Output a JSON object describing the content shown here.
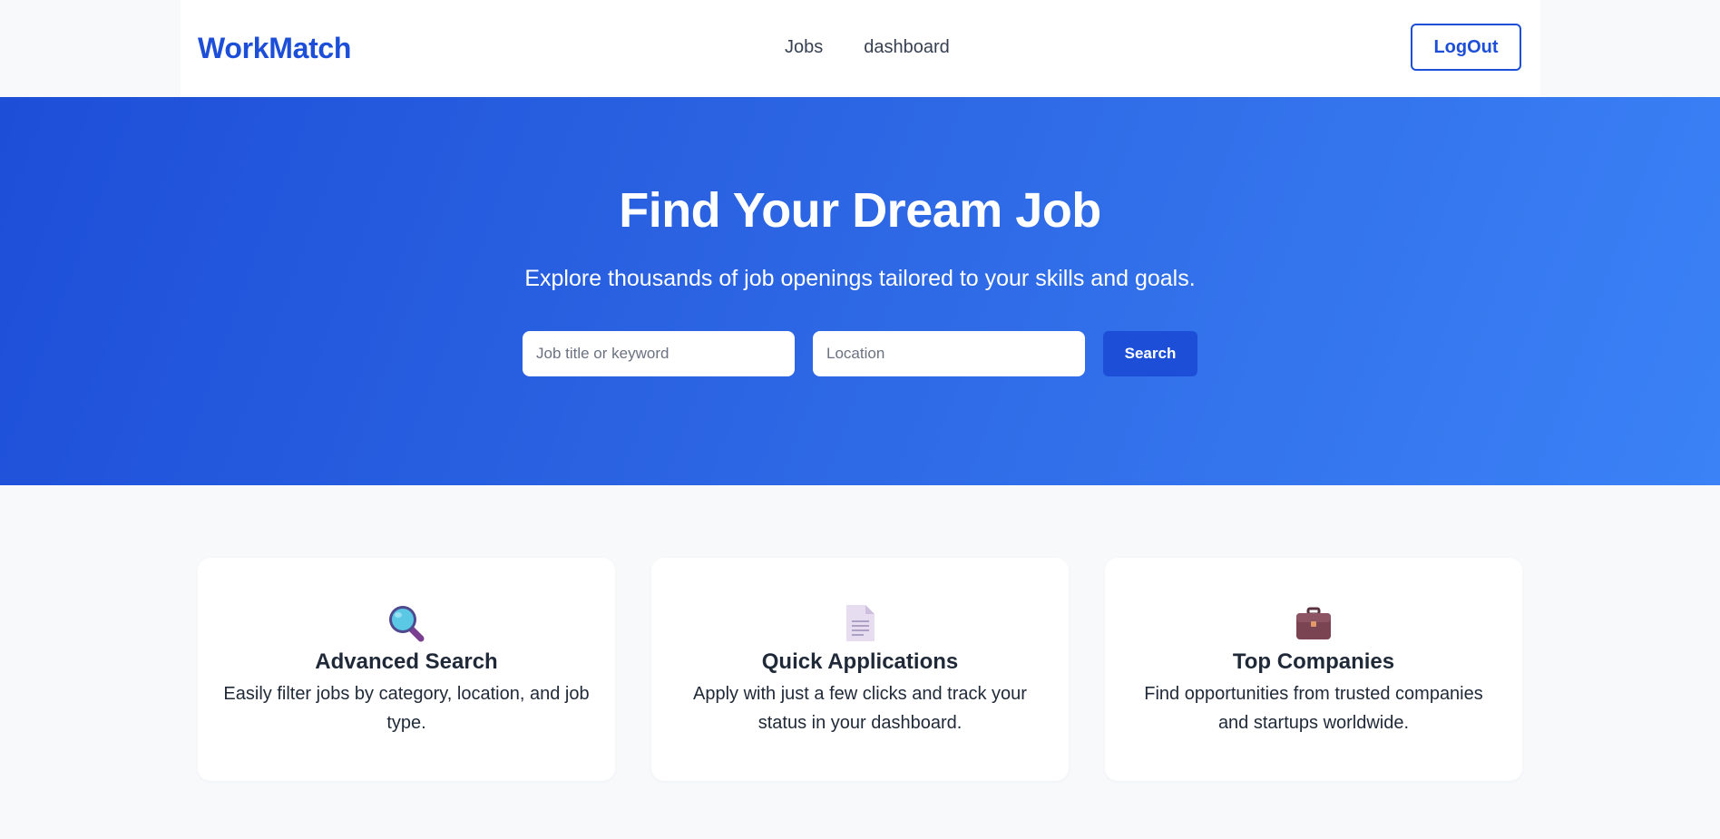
{
  "header": {
    "logo": "WorkMatch",
    "nav": [
      {
        "label": "Jobs"
      },
      {
        "label": "dashboard"
      }
    ],
    "logout_label": "LogOut"
  },
  "hero": {
    "title": "Find Your Dream Job",
    "subtitle": "Explore thousands of job openings tailored to your skills and goals.",
    "keyword_placeholder": "Job title or keyword",
    "keyword_value": "",
    "location_placeholder": "Location",
    "location_value": "",
    "search_label": "Search"
  },
  "features": [
    {
      "icon": "magnifying-glass-icon",
      "title": "Advanced Search",
      "description": "Easily filter jobs by category, location, and job type."
    },
    {
      "icon": "document-icon",
      "title": "Quick Applications",
      "description": "Apply with just a few clicks and track your status in your dashboard."
    },
    {
      "icon": "briefcase-icon",
      "title": "Top Companies",
      "description": "Find opportunities from trusted companies and startups worldwide."
    }
  ],
  "colors": {
    "brand": "#1d4ed8",
    "hero_gradient_start": "#1d4ed8",
    "hero_gradient_end": "#3b82f6",
    "page_background": "#f8f9fb"
  }
}
